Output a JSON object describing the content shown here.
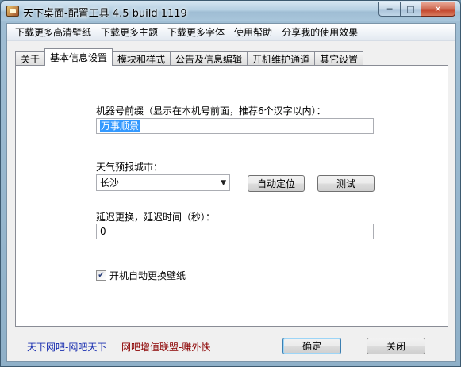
{
  "window": {
    "title": "天下桌面-配置工具 4.5 build 1119",
    "controls": {
      "minimize": "─",
      "maximize": "□",
      "close": "✕"
    }
  },
  "menu": [
    "下载更多高清壁纸",
    "下载更多主题",
    "下载更多字体",
    "使用帮助",
    "分享我的使用效果"
  ],
  "tabs": [
    {
      "label": "关于",
      "active": false
    },
    {
      "label": "基本信息设置",
      "active": true
    },
    {
      "label": "模块和样式",
      "active": false
    },
    {
      "label": "公告及信息编辑",
      "active": false
    },
    {
      "label": "开机维护通道",
      "active": false
    },
    {
      "label": "其它设置",
      "active": false
    }
  ],
  "form": {
    "prefix_label": "机器号前缀（显示在本机号前面，推荐6个汉字以内）：",
    "prefix_value": "万事顺景",
    "city_label": "天气预报城市：",
    "city_value": "长沙",
    "auto_locate_label": "自动定位",
    "test_label": "测试",
    "delay_label": "延迟更换，延迟时间（秒）：",
    "delay_value": "0",
    "auto_wallpaper_label": "开机自动更换壁纸",
    "auto_wallpaper_checked": true
  },
  "footer": {
    "link1": "天下网吧-网吧天下",
    "link1_color": "#1a2fb0",
    "link2": "网吧增值联盟-赚外快",
    "link2_color": "#8b0000",
    "ok_label": "确定",
    "close_label": "关闭"
  }
}
